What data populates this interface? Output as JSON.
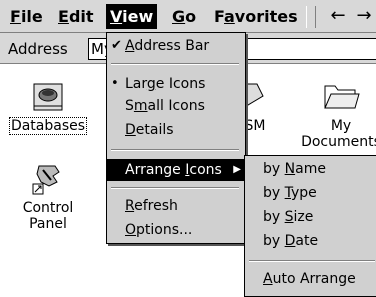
{
  "menubar": {
    "file": {
      "first": "F",
      "rest": "ile"
    },
    "edit": {
      "first": "E",
      "rest": "dit"
    },
    "view": {
      "first": "V",
      "rest": "iew"
    },
    "go": {
      "first": "G",
      "rest": "o"
    },
    "favorites": {
      "pre": "F",
      "u": "a",
      "rest": "vorites"
    },
    "back_arrow": "←",
    "forward_arrow": "→"
  },
  "address": {
    "label": "Address",
    "value": "My"
  },
  "desktop": {
    "items": [
      {
        "label": "Databases",
        "icon": "database-icon"
      },
      {
        "label": "SM",
        "icon": "folder-icon"
      },
      {
        "label1": "My",
        "label2": "Documents",
        "icon": "folder-icon"
      },
      {
        "label1": "Control",
        "label2": "Panel",
        "icon": "control-panel-icon"
      }
    ]
  },
  "view_menu": {
    "address_bar": {
      "u": "A",
      "rest": "ddress Bar",
      "check": "✔"
    },
    "large_icons": {
      "pre": "Lar",
      "u": "g",
      "rest": "e Icons",
      "bullet": "•"
    },
    "small_icons": {
      "pre": "S",
      "u": "m",
      "rest": "all Icons"
    },
    "details": {
      "u": "D",
      "rest": "etails"
    },
    "arrange_icons": {
      "pre": "Arrange ",
      "u": "I",
      "rest": "cons",
      "arrow": "▶"
    },
    "refresh": {
      "u": "R",
      "rest": "efresh"
    },
    "options": {
      "u": "O",
      "rest": "ptions..."
    }
  },
  "arrange_submenu": {
    "by_name": {
      "pre": "by ",
      "u": "N",
      "rest": "ame"
    },
    "by_type": {
      "pre": "by ",
      "u": "T",
      "rest": "ype"
    },
    "by_size": {
      "pre": "by ",
      "u": "S",
      "rest": "ize"
    },
    "by_date": {
      "pre": "by ",
      "u": "D",
      "rest": "ate"
    },
    "auto_arrange": {
      "u": "A",
      "rest": "uto Arrange"
    }
  }
}
